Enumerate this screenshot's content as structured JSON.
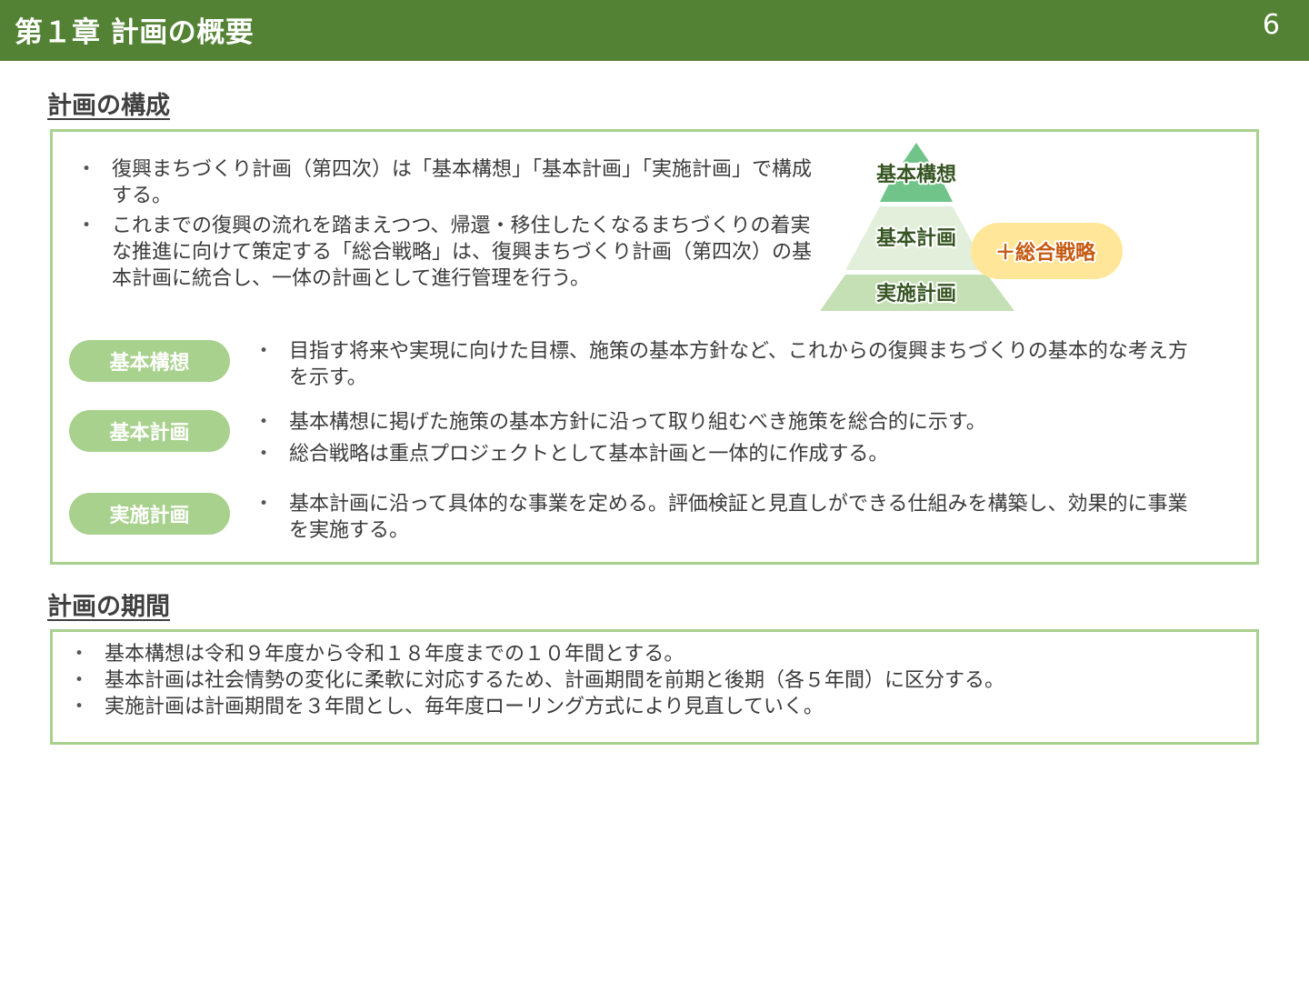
{
  "header": {
    "title": "第１章 計画の概要",
    "page_number": "6"
  },
  "composition": {
    "heading": "計画の構成",
    "intro_bullets": [
      "復興まちづくり計画（第四次）は「基本構想」「基本計画」「実施計画」で構成する。",
      "これまでの復興の流れを踏まえつつ、帰還・移住したくなるまちづくりの着実な推進に向けて策定する「総合戦略」は、復興まちづくり計画（第四次）の基本計画に統合し、一体の計画として進行管理を行う。"
    ],
    "pyramid": {
      "top": "基本構想",
      "middle": "基本計画",
      "bottom": "実施計画",
      "addon": "＋総合戦略"
    },
    "items": [
      {
        "label": "基本構想",
        "bullets": [
          "目指す将来や実現に向けた目標、施策の基本方針など、これからの復興まちづくりの基本的な考え方を示す。"
        ]
      },
      {
        "label": "基本計画",
        "bullets": [
          "基本構想に掲げた施策の基本方針に沿って取り組むべき施策を総合的に示す。",
          "総合戦略は重点プロジェクトとして基本計画と一体的に作成する。"
        ]
      },
      {
        "label": "実施計画",
        "bullets": [
          "基本計画に沿って具体的な事業を定める。評価検証と見直しができる仕組みを構築し、効果的に事業を実施する。"
        ]
      }
    ]
  },
  "period": {
    "heading": "計画の期間",
    "bullets": [
      "基本構想は令和９年度から令和１８年度までの１０年間とする。",
      "基本計画は社会情勢の変化に柔軟に対応するため、計画期間を前期と後期（各５年間）に区分する。",
      "実施計画は計画期間を３年間とし、毎年度ローリング方式により見直していく。"
    ]
  },
  "colors": {
    "header_bg": "#548235",
    "panel_border": "#a9d18e",
    "pill_bg": "#a9d18e",
    "pyramid_top": "#70c48a",
    "pyramid_middle": "#e2efda",
    "pyramid_bottom": "#c5e0b4",
    "addon_bg": "#ffe699",
    "addon_text": "#c55a11",
    "pyramid_text": "#375623"
  }
}
